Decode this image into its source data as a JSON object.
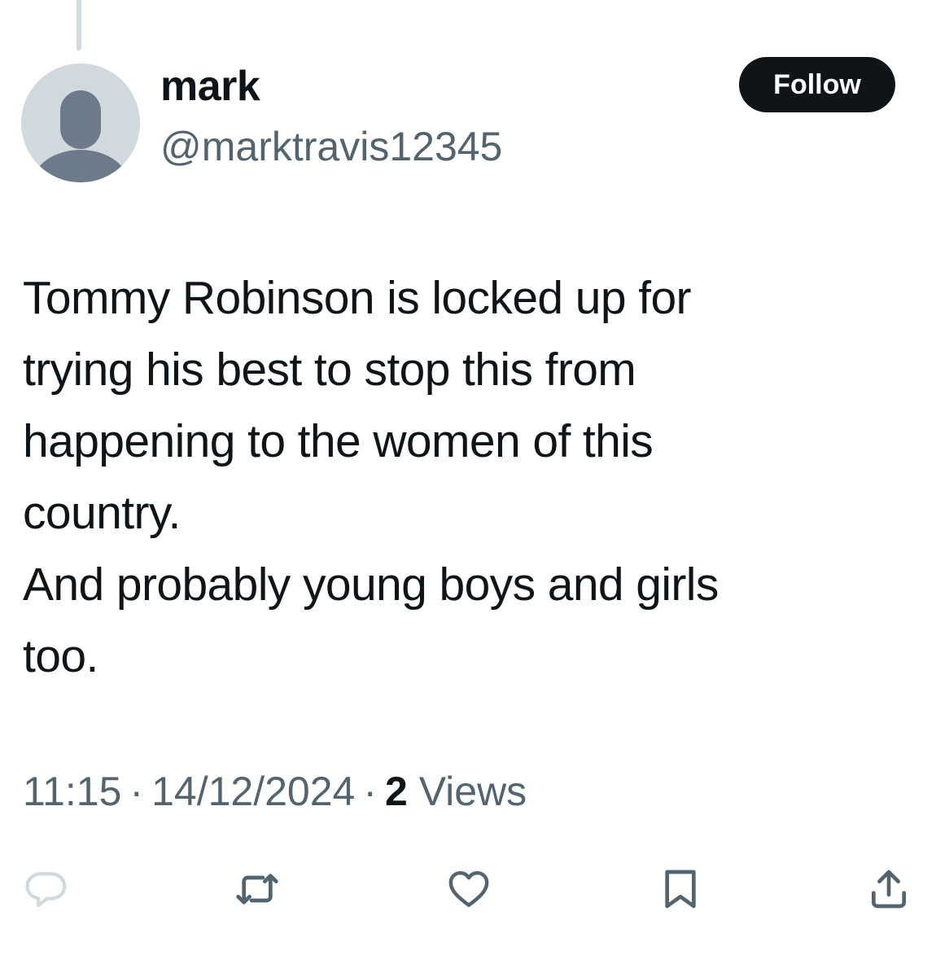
{
  "tweet": {
    "author": {
      "display_name": "mark",
      "handle": "@marktravis12345",
      "avatar_icon": "default-avatar-icon"
    },
    "follow_label": "Follow",
    "text": "Tommy Robinson is locked up for\ntrying his best to stop this from\nhappening to the women of this\ncountry.\nAnd probably young boys and girls\ntoo.",
    "time": "11:15",
    "date": "14/12/2024",
    "separator": "·",
    "views_count": "2",
    "views_label": "Views"
  },
  "actions": [
    {
      "name": "reply",
      "icon": "reply-icon"
    },
    {
      "name": "repost",
      "icon": "repost-icon"
    },
    {
      "name": "like",
      "icon": "heart-icon"
    },
    {
      "name": "bookmark",
      "icon": "bookmark-icon"
    },
    {
      "name": "share",
      "icon": "share-icon"
    }
  ],
  "colors": {
    "text_primary": "#0f1419",
    "text_secondary": "#536471",
    "reply_icon": "#cfd9de",
    "action_icon": "#536471",
    "follow_bg": "#0f1419"
  }
}
